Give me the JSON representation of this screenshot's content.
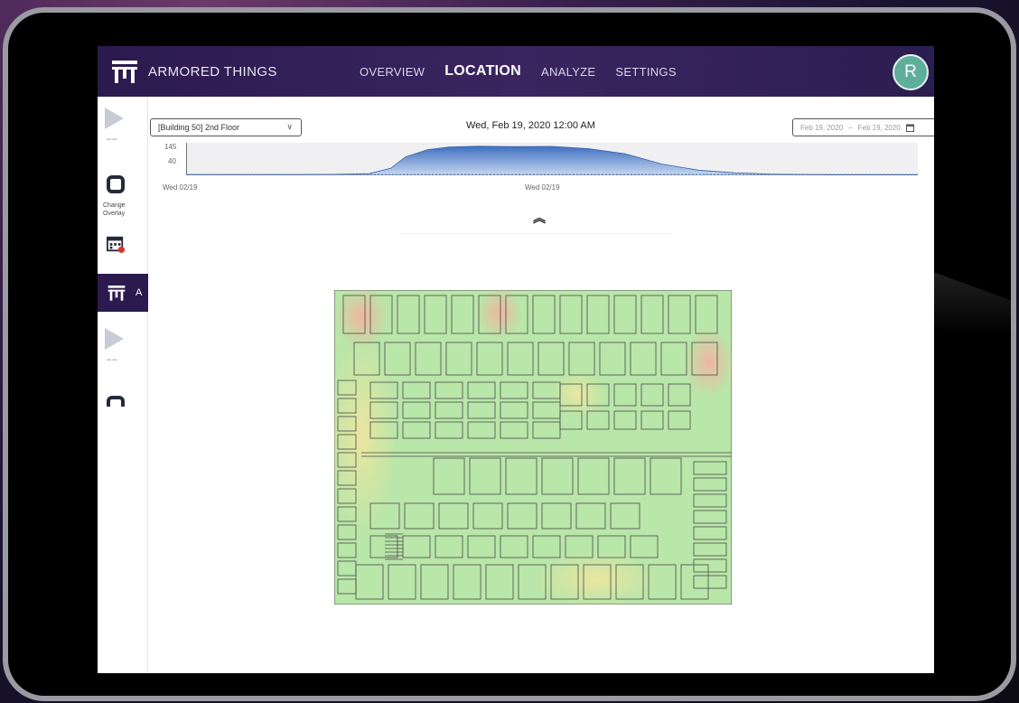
{
  "app": {
    "brand_name": "ARMORED THINGS",
    "avatar_initial": "R",
    "nav": [
      {
        "label": "OVERVIEW",
        "active": false
      },
      {
        "label": "LOCATION",
        "active": true
      },
      {
        "label": "ANALYZE",
        "active": false
      },
      {
        "label": "SETTINGS",
        "active": false
      }
    ],
    "colors": {
      "nav_bg": "#2b1a4e",
      "avatar": "#5fae9c",
      "heat_low": "#b8e3a4",
      "heat_mid": "#e6e9a0",
      "heat_high": "#f0b6a0"
    }
  },
  "rail": {
    "overlay_label_1": "Change",
    "overlay_label_2": "Overlay",
    "brand_initial": "A",
    "icons": [
      "play-icon",
      "overlay-icon",
      "calendar-icon",
      "logo-icon"
    ]
  },
  "controls": {
    "floor_select_value": "[Building 50] 2nd Floor",
    "current_time": "Wed, Feb 19, 2020 12:00 AM",
    "date_range_start": "Feb 19, 2020",
    "date_range_sep": "–",
    "date_range_end": "Feb 19, 2020"
  },
  "timeline": {
    "y_max_label": "145",
    "y_mid_label": "40",
    "x_label_start": "Wed 02/19",
    "x_label_mid": "Wed 02/19",
    "series": [
      {
        "t": 0.0,
        "v": 4
      },
      {
        "t": 0.05,
        "v": 4
      },
      {
        "t": 0.1,
        "v": 4
      },
      {
        "t": 0.15,
        "v": 4
      },
      {
        "t": 0.2,
        "v": 5
      },
      {
        "t": 0.25,
        "v": 8
      },
      {
        "t": 0.28,
        "v": 35
      },
      {
        "t": 0.3,
        "v": 90
      },
      {
        "t": 0.33,
        "v": 125
      },
      {
        "t": 0.36,
        "v": 138
      },
      {
        "t": 0.4,
        "v": 142
      },
      {
        "t": 0.45,
        "v": 140
      },
      {
        "t": 0.5,
        "v": 141
      },
      {
        "t": 0.55,
        "v": 130
      },
      {
        "t": 0.6,
        "v": 105
      },
      {
        "t": 0.65,
        "v": 55
      },
      {
        "t": 0.7,
        "v": 25
      },
      {
        "t": 0.75,
        "v": 12
      },
      {
        "t": 0.8,
        "v": 6
      },
      {
        "t": 0.85,
        "v": 4
      },
      {
        "t": 0.9,
        "v": 3
      },
      {
        "t": 0.95,
        "v": 3
      },
      {
        "t": 1.0,
        "v": 3
      }
    ]
  }
}
